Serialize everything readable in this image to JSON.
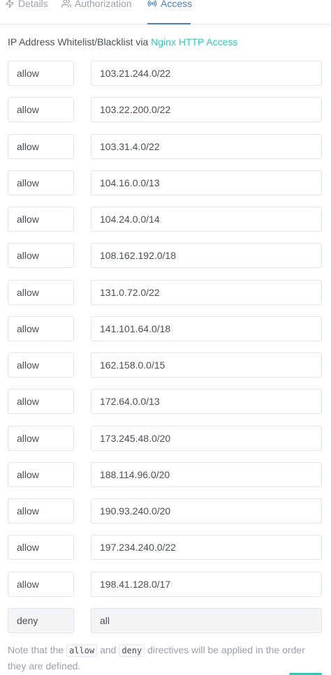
{
  "tabs": [
    {
      "label": "Details",
      "icon": "bolt-icon",
      "active": false
    },
    {
      "label": "Authorization",
      "icon": "users-icon",
      "active": false
    },
    {
      "label": "Access",
      "icon": "broadcast-icon",
      "active": true
    }
  ],
  "intro": {
    "text": "IP Address Whitelist/Blacklist via ",
    "link": "Nginx HTTP Access"
  },
  "rules": [
    {
      "directive": "allow",
      "address": "103.21.244.0/22"
    },
    {
      "directive": "allow",
      "address": "103.22.200.0/22"
    },
    {
      "directive": "allow",
      "address": "103.31.4.0/22"
    },
    {
      "directive": "allow",
      "address": "104.16.0.0/13"
    },
    {
      "directive": "allow",
      "address": "104.24.0.0/14"
    },
    {
      "directive": "allow",
      "address": "108.162.192.0/18"
    },
    {
      "directive": "allow",
      "address": "131.0.72.0/22"
    },
    {
      "directive": "allow",
      "address": "141.101.64.0/18"
    },
    {
      "directive": "allow",
      "address": "162.158.0.0/15"
    },
    {
      "directive": "allow",
      "address": "172.64.0.0/13"
    },
    {
      "directive": "allow",
      "address": "173.245.48.0/20"
    },
    {
      "directive": "allow",
      "address": "188.114.96.0/20"
    },
    {
      "directive": "allow",
      "address": "190.93.240.0/20"
    },
    {
      "directive": "allow",
      "address": "197.234.240.0/22"
    },
    {
      "directive": "allow",
      "address": "198.41.128.0/17"
    }
  ],
  "final_rule": {
    "directive": "deny",
    "address": "all"
  },
  "note": {
    "prefix": "Note that the ",
    "code1": "allow",
    "middle": " and ",
    "code2": "deny",
    "suffix": " directives will be applied in the order they are defined."
  },
  "colors": {
    "accent": "#467fcf",
    "link": "#2bcbba",
    "text": "#495057",
    "muted": "#9aa0ac"
  }
}
